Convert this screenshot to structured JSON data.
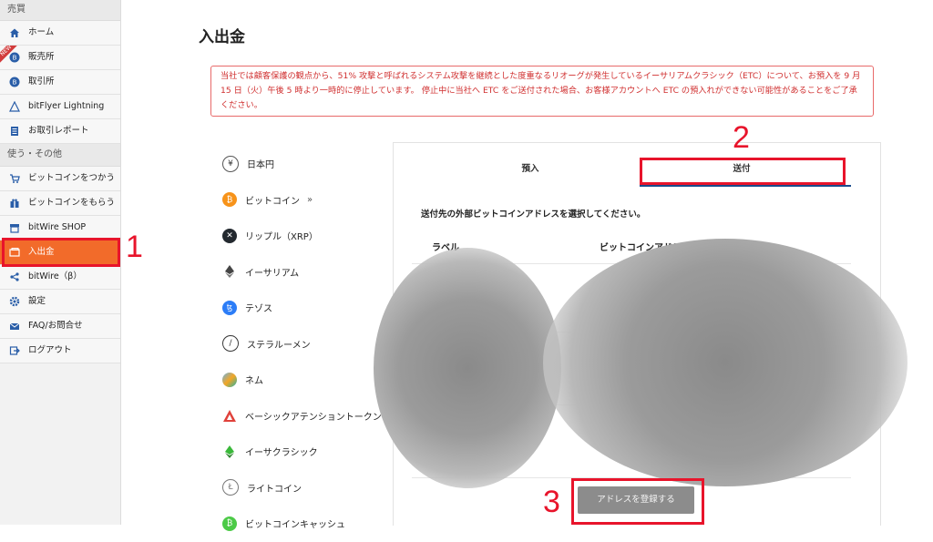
{
  "sidebar": {
    "section1": "売買",
    "items1": [
      {
        "label": "ホーム"
      },
      {
        "label": "販売所",
        "badge": "NEW"
      },
      {
        "label": "取引所"
      },
      {
        "label": "bitFlyer Lightning"
      },
      {
        "label": "お取引レポート"
      }
    ],
    "section2": "使う・その他",
    "items2": [
      {
        "label": "ビットコインをつかう"
      },
      {
        "label": "ビットコインをもらう"
      },
      {
        "label": "bitWire SHOP"
      },
      {
        "label": "入出金"
      },
      {
        "label": "bitWire（β）"
      },
      {
        "label": "設定"
      },
      {
        "label": "FAQ/お問合せ"
      },
      {
        "label": "ログアウト"
      }
    ]
  },
  "page": {
    "title": "入出金",
    "notice": "当社では顧客保護の観点から、51% 攻撃と呼ばれるシステム攻撃を継続とした度重なるリオーグが発生しているイーサリアムクラシック（ETC）について、お預入を 9 月 15 日（火）午後 5 時より一時的に停止しています。 停止中に当社へ ETC をご送付された場合、お客様アカウントへ ETC の預入れができない可能性があることをご了承ください。"
  },
  "currencies": [
    {
      "label": "日本円",
      "icon": "yen-icon"
    },
    {
      "label": "ビットコイン",
      "icon": "bitcoin-icon",
      "suffix": "»"
    },
    {
      "label": "リップル（XRP）",
      "icon": "xrp-icon"
    },
    {
      "label": "イーサリアム",
      "icon": "ethereum-icon"
    },
    {
      "label": "テゾス",
      "icon": "tezos-icon"
    },
    {
      "label": "ステラルーメン",
      "icon": "stellar-icon"
    },
    {
      "label": "ネム",
      "icon": "nem-icon"
    },
    {
      "label": "ベーシックアテンショントークン",
      "icon": "bat-icon"
    },
    {
      "label": "イーサクラシック",
      "icon": "etc-icon"
    },
    {
      "label": "ライトコイン",
      "icon": "litecoin-icon"
    },
    {
      "label": "ビットコインキャッシュ",
      "icon": "bch-icon"
    }
  ],
  "panel": {
    "tabs": [
      {
        "label": "預入"
      },
      {
        "label": "送付"
      }
    ],
    "instruction": "送付先の外部ビットコインアドレスを選択してください。",
    "col_label": "ラベル",
    "col_address": "ビットコインアドレス",
    "register_button": "アドレスを登録する"
  },
  "annotations": {
    "n1": "1",
    "n2": "2",
    "n3": "3"
  },
  "colors": {
    "accent": "#f26b2a",
    "highlight": "#e8142b",
    "tab_underline": "#1a4b8c"
  }
}
